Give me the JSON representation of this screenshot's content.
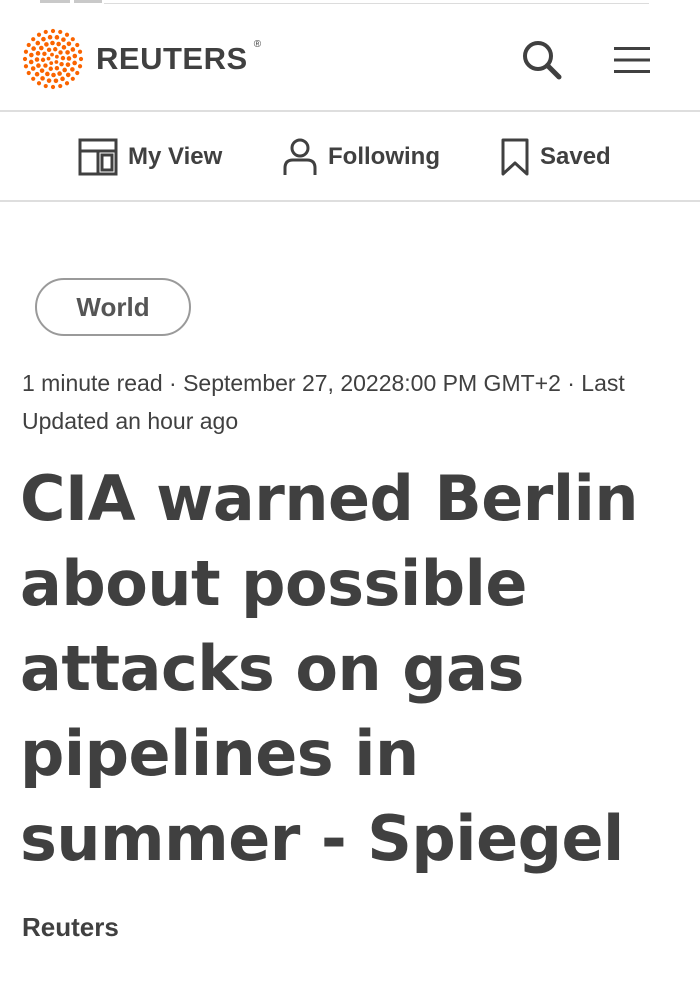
{
  "header": {
    "brand": "REUTERS",
    "brand_mark": "®",
    "brand_color": "#fa6400",
    "icons": [
      "reuters-logo-icon",
      "search-icon",
      "hamburger-menu-icon"
    ]
  },
  "subnav": {
    "items": [
      {
        "label": "My View",
        "icon": "layout-grid-icon"
      },
      {
        "label": "Following",
        "icon": "person-icon"
      },
      {
        "label": "Saved",
        "icon": "bookmark-icon"
      }
    ]
  },
  "article": {
    "section": "World",
    "meta_line": "1 minute read · September 27, 20228:00 PM GMT+2 · Last Updated an hour ago",
    "headline": "CIA warned Berlin about possible attacks on gas pipelines in summer - Spiegel",
    "byline": "Reuters"
  }
}
